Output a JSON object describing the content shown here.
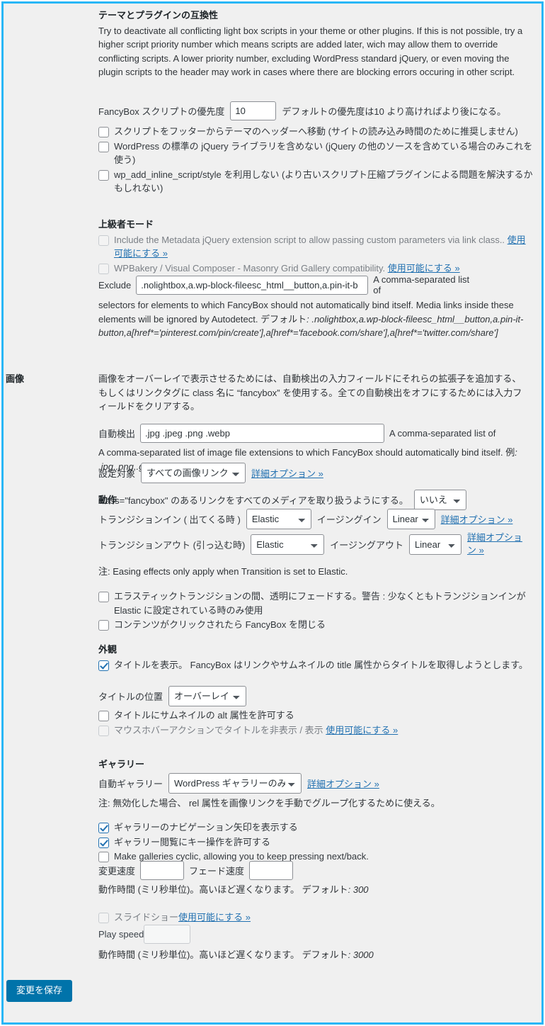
{
  "theme_compat": {
    "heading": "テーマとプラグインの互換性",
    "description": "Try to deactivate all conflicting light box scripts in your theme or other plugins. If this is not possible, try a higher script priority number which means scripts are added later, wich may allow them to override conflicting scripts. A lower priority number, excluding WordPress standard jQuery, or even moving the plugin scripts to the header may work in cases where there are blocking errors occuring in other script.",
    "priority_label": "FancyBox スクリプトの優先度",
    "priority_value": "10",
    "priority_hint": "デフォルトの優先度は10 より高ければより後になる。",
    "checkbox_move_header": "スクリプトをフッターからテーマのヘッダーへ移動 (サイトの読み込み時間のために推奨しません)",
    "checkbox_no_jquery": "WordPress の標準の jQuery ライブラリを含めない (jQuery の他のソースを含めている場合のみこれを使う)",
    "checkbox_no_inline": "wp_add_inline_script/style を利用しない (より古いスクリプト圧縮プラグインによる問題を解決するかもしれない)"
  },
  "advanced": {
    "heading": "上級者モード",
    "metadata_label": "Include the Metadata jQuery extension script to allow passing custom parameters via link class..",
    "metadata_link": "使用可能にする »",
    "wpbakery_label": "WPBakery / Visual Composer - Masonry Grid Gallery compatibility.",
    "wpbakery_link": "使用可能にする »",
    "exclude_label": "Exclude",
    "exclude_value": ".nolightbox,a.wp-block-fileesc_html__button,a.pin-it-b",
    "exclude_hint_1": "A comma-separated list of selectors for elements to which FancyBox should not automatically bind itself. Media links inside these elements will be ignored by Autodetect.",
    "exclude_hint_default_label": "デフォルト",
    "exclude_hint_default_value": ": .nolightbox,a.wp-block-fileesc_html__button,a.pin-it-button,a[href*='pinterest.com/pin/create'],a[href*='facebook.com/share'],a[href*='twitter.com/share']"
  },
  "images": {
    "section_label": "画像",
    "description": "画像をオーバーレイで表示させるためには、自動検出の入力フィールドにそれらの拡張子を追加する、もしくはリンクタグに class 名に “fancybox” を使用する。全ての自動検出をオフにするためには入力フィールドをクリアする。",
    "autodetect_label": "自動検出",
    "autodetect_value": ".jpg .jpeg .png .webp",
    "autodetect_hint": "A comma-separated list of image file extensions to which FancyBox should automatically bind itself.",
    "autodetect_example_label": "例",
    "autodetect_example_value": ": .jpg,.png,.gif,.jpeg",
    "target_label": "設定対象",
    "target_value": "すべての画像リンク",
    "target_options": [
      "すべての画像リンク"
    ],
    "target_link": "詳細オプション »",
    "fancybox_class_text": "class=\"fancybox\" のあるリンクをすべてのメディアを取り扱うようにする。",
    "fancybox_class_value": "いいえ",
    "fancybox_class_options": [
      "いいえ"
    ]
  },
  "behavior": {
    "heading": "動作",
    "transition_in_label": "トランジションイン ( 出てくる時 )",
    "transition_in_value": "Elastic",
    "transition_options": [
      "Elastic"
    ],
    "easing_in_label": "イージングイン",
    "easing_in_value": "Linear",
    "easing_options": [
      "Linear"
    ],
    "transition_in_link": "詳細オプション »",
    "transition_out_label": "トランジションアウト (引っ込む時)",
    "transition_out_value": "Elastic",
    "easing_out_label": "イージングアウト",
    "easing_out_value": "Linear",
    "transition_out_link": "詳細オプション »",
    "note": "注: Easing effects only apply when Transition is set to Elastic.",
    "checkbox_fade": "エラスティックトランジションの間、透明にフェードする。警告 : 少なくともトランジションインが Elastic に設定されている時のみ使用",
    "checkbox_click_close": "コンテンツがクリックされたら FancyBox を閉じる"
  },
  "appearance": {
    "heading": "外観",
    "checkbox_show_title": "タイトルを表示。 FancyBox はリンクやサムネイルの title 属性からタイトルを取得しようとします。",
    "title_position_label": "タイトルの位置",
    "title_position_value": "オーバーレイ",
    "title_position_options": [
      "オーバーレイ"
    ],
    "checkbox_alt_attr": "タイトルにサムネイルの alt 属性を許可する",
    "checkbox_hover": "マウスホバーアクションでタイトルを非表示 / 表示",
    "hover_link": "使用可能にする »"
  },
  "gallery": {
    "heading": "ギャラリー",
    "auto_gallery_label": "自動ギャラリー",
    "auto_gallery_value": "WordPress ギャラリーのみ",
    "auto_gallery_options": [
      "WordPress ギャラリーのみ"
    ],
    "auto_gallery_link": "詳細オプション »",
    "note": "注: 無効化した場合、 rel 属性を画像リンクを手動でグループ化するために使える。",
    "checkbox_nav_arrows": "ギャラリーのナビゲーション矢印を表示する",
    "checkbox_keyboard": "ギャラリー閲覧にキー操作を許可する",
    "checkbox_cyclic": "Make galleries cyclic, allowing you to keep pressing next/back.",
    "change_speed_label": "変更速度",
    "change_speed_value": "",
    "fade_speed_label": "フェード速度",
    "fade_speed_value": "",
    "speed_hint": "動作時間 (ミリ秒単位)。高いほど遅くなります。",
    "speed_hint_default_label": "デフォルト",
    "speed_hint_default_value": ": 300"
  },
  "slideshow": {
    "checkbox_slideshow": "スライドショー",
    "slideshow_link": "使用可能にする »",
    "play_speed_label": "Play speed",
    "play_speed_value": "",
    "play_hint": "動作時間 (ミリ秒単位)。高いほど遅くなります。",
    "play_hint_default_label": "デフォルト",
    "play_hint_default_value": ": 3000"
  },
  "footer": {
    "save_label": "変更を保存"
  },
  "colors": {
    "accent_border": "#29b6f6",
    "primary_button": "#0073aa",
    "link": "#2271b1",
    "background": "#f0f0f0"
  }
}
